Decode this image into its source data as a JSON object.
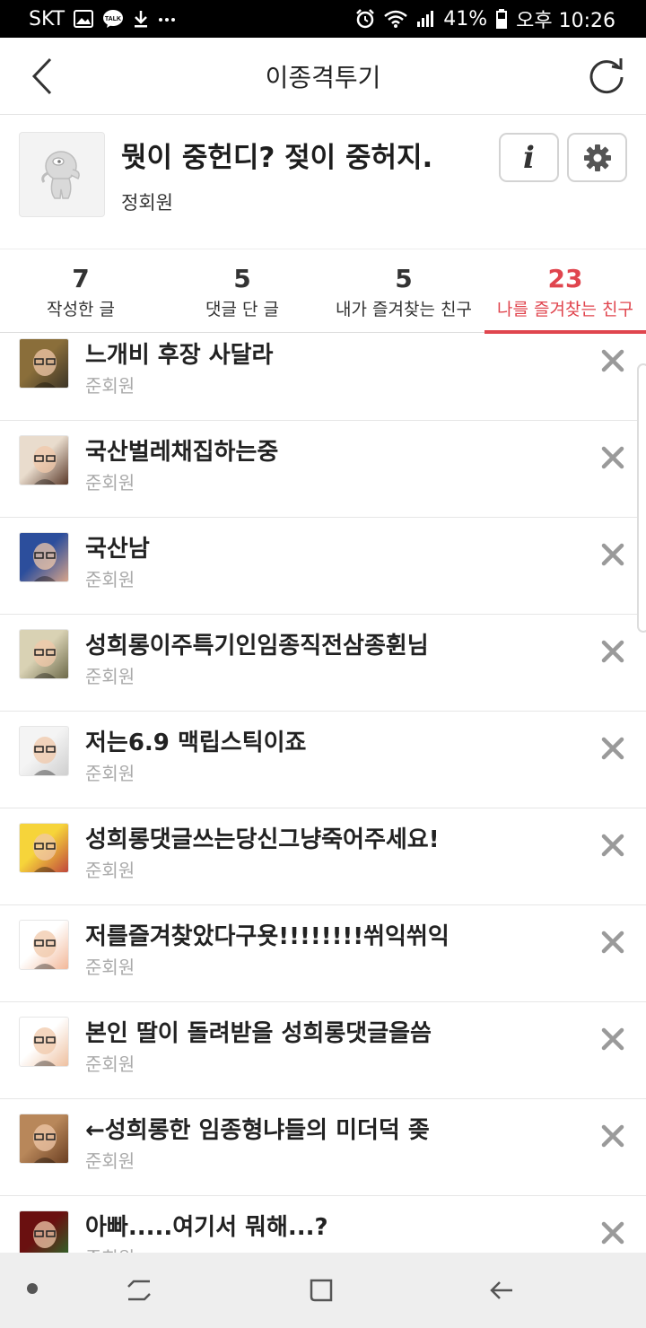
{
  "status_bar": {
    "carrier": "SKT",
    "battery": "41%",
    "time": "오후 10:26",
    "icons": [
      "gallery-icon",
      "kakaotalk-icon",
      "download-icon",
      "more-icon",
      "alarm-icon",
      "wifi-icon",
      "signal-icon",
      "battery-icon"
    ]
  },
  "app_bar": {
    "title": "이종격투기",
    "back_icon": "chevron-left-icon",
    "refresh_icon": "refresh-icon"
  },
  "profile": {
    "name": "뭣이 중헌디? 젖이 중허지.",
    "grade": "정회원",
    "info_label": "i",
    "settings_icon": "gear-icon"
  },
  "tabs": [
    {
      "count": "7",
      "label": "작성한 글",
      "active": false
    },
    {
      "count": "5",
      "label": "댓글 단 글",
      "active": false
    },
    {
      "count": "5",
      "label": "내가 즐겨찾는 친구",
      "active": false
    },
    {
      "count": "23",
      "label": "나를 즐겨찾는 친구",
      "active": true
    }
  ],
  "friends": [
    {
      "name": "느개비 후장 사달라",
      "grade": "준회원",
      "avatar_colors": [
        "#8a6e3a",
        "#3c3426"
      ]
    },
    {
      "name": "국산벌레채집하는중",
      "grade": "준회원",
      "avatar_colors": [
        "#e9dccd",
        "#5b3a2a"
      ]
    },
    {
      "name": "국산남",
      "grade": "준회원",
      "avatar_colors": [
        "#2c4e9c",
        "#d7a48a"
      ]
    },
    {
      "name": "성희롱이주특기인임종직전삼종휜님",
      "grade": "준회원",
      "avatar_colors": [
        "#d9d2b4",
        "#6d6a4a"
      ]
    },
    {
      "name": "저는6.9 맥립스틱이죠",
      "grade": "준회원",
      "avatar_colors": [
        "#f4f4f4",
        "#cfcfcf"
      ]
    },
    {
      "name": "성희롱댓글쓰는당신그냥죽어주세요!",
      "grade": "준회원",
      "avatar_colors": [
        "#f6d43a",
        "#c0483c"
      ]
    },
    {
      "name": "저를즐겨찾았다구욧!!!!!!!!쒸익쒸익",
      "grade": "준회원",
      "avatar_colors": [
        "#ffffff",
        "#f2b899"
      ]
    },
    {
      "name": "본인 딸이 돌려받을 성희롱댓글을씀",
      "grade": "준회원",
      "avatar_colors": [
        "#ffffff",
        "#eec0a0"
      ]
    },
    {
      "name": "←성희롱한 임종형냐들의 미더덕 좆",
      "grade": "준회원",
      "avatar_colors": [
        "#b8875a",
        "#6b3f22"
      ]
    },
    {
      "name": "아빠.....여기서 뭐해...?",
      "grade": "준회원",
      "avatar_colors": [
        "#6a1010",
        "#2b6a2b"
      ]
    }
  ],
  "nav_bar": {
    "icons": [
      "dot-icon",
      "recent-apps-icon",
      "home-icon",
      "back-arrow-icon"
    ]
  }
}
